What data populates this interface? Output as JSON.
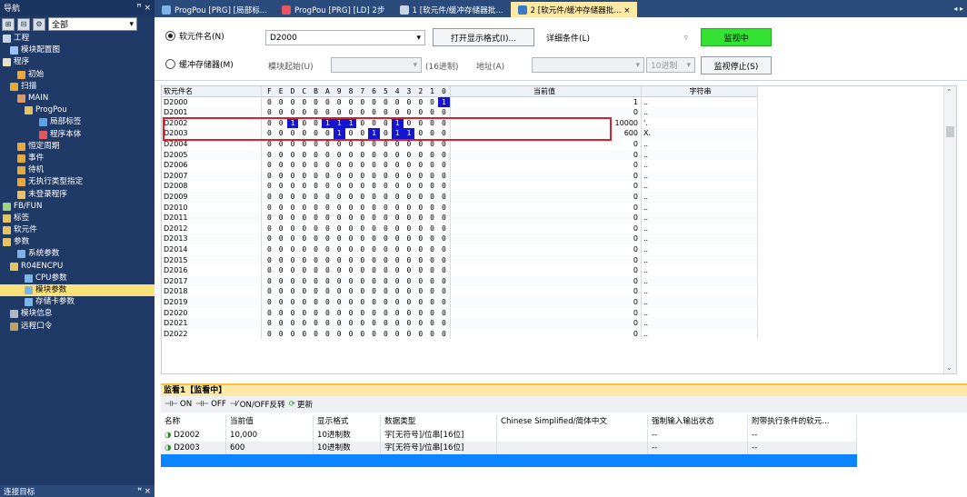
{
  "nav": {
    "title": "导航",
    "pin": "ꟸ ×",
    "filter": "全部",
    "items": [
      {
        "label": "工程",
        "indent": 0,
        "color": "#c9d4e6"
      },
      {
        "label": "模块配置图",
        "indent": 1,
        "color": "#9bc2ff"
      },
      {
        "label": "程序",
        "indent": 0,
        "color": "#e9e0c8"
      },
      {
        "label": "初始",
        "indent": 2,
        "color": "#e8a93b"
      },
      {
        "label": "扫描",
        "indent": 1,
        "color": "#e8a93b"
      },
      {
        "label": "MAIN",
        "indent": 2,
        "color": "#d99a6b"
      },
      {
        "label": "ProgPou",
        "indent": 3,
        "color": "#e6c35d"
      },
      {
        "label": "局部标签",
        "indent": 5,
        "color": "#5fa3e6"
      },
      {
        "label": "程序本体",
        "indent": 5,
        "color": "#e6565f"
      },
      {
        "label": "恒定周期",
        "indent": 2,
        "color": "#e8a93b"
      },
      {
        "label": "事件",
        "indent": 2,
        "color": "#e8a93b"
      },
      {
        "label": "待机",
        "indent": 2,
        "color": "#e8a93b"
      },
      {
        "label": "无执行类型指定",
        "indent": 2,
        "color": "#e8a93b"
      },
      {
        "label": "未登录程序",
        "indent": 2,
        "color": "#e8c06a"
      },
      {
        "label": "FB/FUN",
        "indent": 0,
        "color": "#9ed37a"
      },
      {
        "label": "标签",
        "indent": 0,
        "color": "#e6c35d"
      },
      {
        "label": "软元件",
        "indent": 0,
        "color": "#e6c35d"
      },
      {
        "label": "参数",
        "indent": 0,
        "color": "#e6c35d"
      },
      {
        "label": "系统参数",
        "indent": 2,
        "color": "#7ab6e6"
      },
      {
        "label": "R04ENCPU",
        "indent": 1,
        "color": "#e6c35d"
      },
      {
        "label": "CPU参数",
        "indent": 3,
        "color": "#7ab6e6"
      },
      {
        "label": "模块参数",
        "indent": 3,
        "color": "#7ab6e6",
        "selected": true
      },
      {
        "label": "存储卡参数",
        "indent": 3,
        "color": "#7ab6e6"
      },
      {
        "label": "模块信息",
        "indent": 1,
        "color": "#b0b7c3"
      },
      {
        "label": "远程口令",
        "indent": 1,
        "color": "#c0a15d"
      }
    ],
    "footer": "连接目标",
    "footer_pin": "ꟸ ×"
  },
  "tabs": [
    {
      "label": "ProgPou [PRG] [局部标...",
      "color": "#7ab6e6"
    },
    {
      "label": "ProgPou [PRG] [LD] 2步",
      "color": "#e6565f"
    },
    {
      "label": "1 [软元件/缓冲存储器批...",
      "color": "#c9d4e6"
    },
    {
      "label": "2 [软元件/缓冲存储器批... ×",
      "color": "#3a78c9",
      "active": true
    }
  ],
  "tabs_right": "◂ ▸",
  "toolbar": {
    "device_radio": "软元件名(N)",
    "device_value": "D2000",
    "buffer_radio": "缓冲存储器(M)",
    "module_start": "模块起始(U)",
    "hex_label": "(16进制)",
    "address_label": "地址(A)",
    "decimal_select": "10进制",
    "open_format_btn": "打开显示格式(I)...",
    "detail_cond": "详细条件(L)",
    "monitoring_btn": "监视中",
    "stop_btn": "监视停止(S)"
  },
  "grid": {
    "headers": {
      "name": "软元件名",
      "bits": [
        "F",
        "E",
        "D",
        "C",
        "B",
        "A",
        "9",
        "8",
        "7",
        "6",
        "5",
        "4",
        "3",
        "2",
        "1",
        "0"
      ],
      "value": "当前值",
      "string": "字符串"
    },
    "rows": [
      {
        "name": "D2000",
        "bits": "0000000000000001",
        "value": "1",
        "str": ".."
      },
      {
        "name": "D2001",
        "bits": "0000000000000000",
        "value": "0",
        "str": ".."
      },
      {
        "name": "D2002",
        "bits": "0010011100010000",
        "value": "10000",
        "str": "'."
      },
      {
        "name": "D2003",
        "bits": "0000001001011000",
        "value": "600",
        "str": "X."
      },
      {
        "name": "D2004",
        "bits": "0000000000000000",
        "value": "0",
        "str": ".."
      },
      {
        "name": "D2005",
        "bits": "0000000000000000",
        "value": "0",
        "str": ".."
      },
      {
        "name": "D2006",
        "bits": "0000000000000000",
        "value": "0",
        "str": ".."
      },
      {
        "name": "D2007",
        "bits": "0000000000000000",
        "value": "0",
        "str": ".."
      },
      {
        "name": "D2008",
        "bits": "0000000000000000",
        "value": "0",
        "str": ".."
      },
      {
        "name": "D2009",
        "bits": "0000000000000000",
        "value": "0",
        "str": ".."
      },
      {
        "name": "D2010",
        "bits": "0000000000000000",
        "value": "0",
        "str": ".."
      },
      {
        "name": "D2011",
        "bits": "0000000000000000",
        "value": "0",
        "str": ".."
      },
      {
        "name": "D2012",
        "bits": "0000000000000000",
        "value": "0",
        "str": ".."
      },
      {
        "name": "D2013",
        "bits": "0000000000000000",
        "value": "0",
        "str": ".."
      },
      {
        "name": "D2014",
        "bits": "0000000000000000",
        "value": "0",
        "str": ".."
      },
      {
        "name": "D2015",
        "bits": "0000000000000000",
        "value": "0",
        "str": ".."
      },
      {
        "name": "D2016",
        "bits": "0000000000000000",
        "value": "0",
        "str": ".."
      },
      {
        "name": "D2017",
        "bits": "0000000000000000",
        "value": "0",
        "str": ".."
      },
      {
        "name": "D2018",
        "bits": "0000000000000000",
        "value": "0",
        "str": ".."
      },
      {
        "name": "D2019",
        "bits": "0000000000000000",
        "value": "0",
        "str": ".."
      },
      {
        "name": "D2020",
        "bits": "0000000000000000",
        "value": "0",
        "str": ".."
      },
      {
        "name": "D2021",
        "bits": "0000000000000000",
        "value": "0",
        "str": ".."
      },
      {
        "name": "D2022",
        "bits": "0000000000000000",
        "value": "0",
        "str": ".."
      }
    ]
  },
  "monitor": {
    "title": "监看1【监看中】",
    "tools": [
      "ON",
      "OFF",
      "ON/OFF反转",
      "更新"
    ],
    "headers": [
      "名称",
      "当前值",
      "显示格式",
      "数据类型",
      "Chinese Simplified/简体中文",
      "强制输入输出状态",
      "附带执行条件的软元..."
    ],
    "rows": [
      [
        "D2002",
        "10,000",
        "10进制数",
        "字[无符号]/位串[16位]",
        "",
        "--",
        "--"
      ],
      [
        "D2003",
        "600",
        "10进制数",
        "字[无符号]/位串[16位]",
        "",
        "--",
        "--"
      ]
    ]
  }
}
